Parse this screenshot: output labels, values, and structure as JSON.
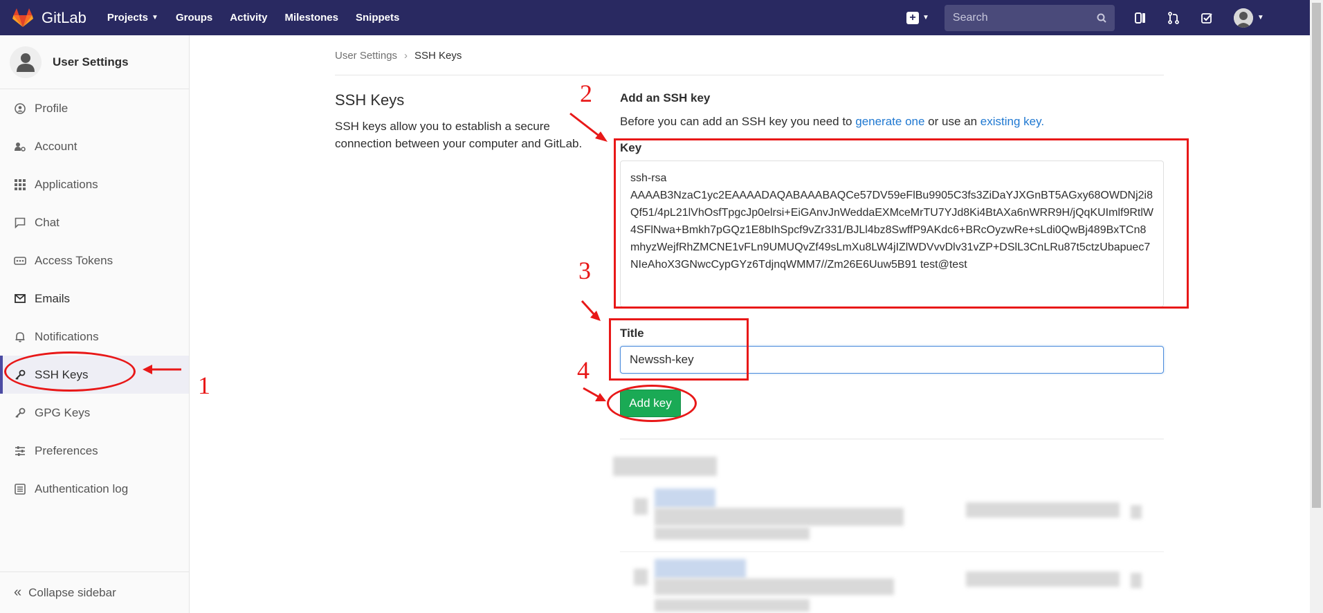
{
  "topbar": {
    "logo_text": "GitLab",
    "nav": [
      {
        "label": "Projects",
        "caret": true
      },
      {
        "label": "Groups",
        "caret": false
      },
      {
        "label": "Activity",
        "caret": false
      },
      {
        "label": "Milestones",
        "caret": false
      },
      {
        "label": "Snippets",
        "caret": false
      }
    ],
    "search_placeholder": "Search",
    "icons": [
      "plus-icon",
      "search-icon",
      "sidebar-toggle-icon",
      "merge-request-icon",
      "todo-check-icon",
      "user-avatar"
    ]
  },
  "sidebar": {
    "title": "User Settings",
    "items": [
      {
        "label": "Profile",
        "icon": "profile-icon"
      },
      {
        "label": "Account",
        "icon": "account-gear-icon"
      },
      {
        "label": "Applications",
        "icon": "applications-grid-icon"
      },
      {
        "label": "Chat",
        "icon": "chat-bubble-icon"
      },
      {
        "label": "Access Tokens",
        "icon": "token-icon"
      },
      {
        "label": "Emails",
        "icon": "envelope-icon"
      },
      {
        "label": "Notifications",
        "icon": "bell-icon"
      },
      {
        "label": "SSH Keys",
        "icon": "key-icon",
        "active": true
      },
      {
        "label": "GPG Keys",
        "icon": "key-icon"
      },
      {
        "label": "Preferences",
        "icon": "sliders-icon"
      },
      {
        "label": "Authentication log",
        "icon": "log-list-icon"
      }
    ],
    "collapse_label": "Collapse sidebar"
  },
  "breadcrumb": {
    "parent": "User Settings",
    "current": "SSH Keys"
  },
  "section": {
    "title": "SSH Keys",
    "description": "SSH keys allow you to establish a secure connection between your computer and GitLab."
  },
  "form": {
    "title": "Add an SSH key",
    "desc_prefix": "Before you can add an SSH key you need to ",
    "desc_link1": "generate one",
    "desc_middle": " or use an ",
    "desc_link2": "existing key.",
    "key_label": "Key",
    "key_value": "ssh-rsa\nAAAAB3NzaC1yc2EAAAADAQABAAABAQCe57DV59eFlBu9905C3fs3ZiDaYJXGnBT5AGxy68OWDNj2i8Qf51/4pL21lVhOsfTpgcJp0elrsi+EiGAnvJnWeddaEXMceMrTU7YJd8Ki4BtAXa6nWRR9H/jQqKUImlf9RtlW4SFlNwa+Bmkh7pGQz1E8bIhSpcf9vZr331/BJLl4bz8SwffP9AKdc6+BRcOyzwRe+sLdi0QwBj489BxTCn8mhyzWejfRhZMCNE1vFLn9UMUQvZf49sLmXu8LW4jIZlWDVvvDlv31vZP+DSlL3CnLRu87t5ctzUbapuec7NIeAhoX3GNwcCypGYz6TdjnqWMM7//Zm26E6Uuw5B91 test@test",
    "title_label": "Title",
    "title_value": "Newssh-key",
    "add_button": "Add key"
  },
  "annotations": {
    "numbers": [
      "1",
      "2",
      "3",
      "4"
    ],
    "color": "#e81818"
  },
  "colors": {
    "topbar": "#292961",
    "accent_green": "#1aaa55",
    "link_blue": "#1f78d1",
    "active_indicator": "#4b4ba3"
  }
}
